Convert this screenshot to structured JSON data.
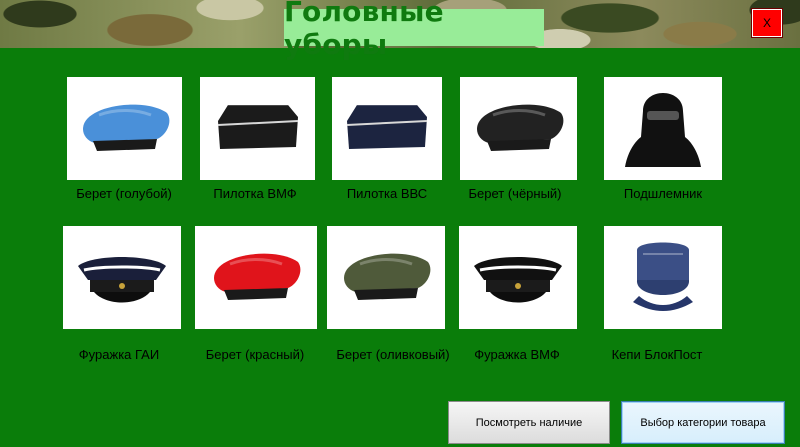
{
  "window": {
    "title": "Головные уборы",
    "close_label": "X"
  },
  "products": [
    {
      "label": "Берет (голубой)",
      "icon": "beret-icon",
      "color": "#4a90d9"
    },
    {
      "label": "Пилотка ВМФ",
      "icon": "garrison-cap-icon",
      "color": "#1b1b1b"
    },
    {
      "label": "Пилотка ВВС",
      "icon": "garrison-cap-icon",
      "color": "#1c2440"
    },
    {
      "label": "Берет (чёрный)",
      "icon": "beret-icon",
      "color": "#222222"
    },
    {
      "label": "Подшлемник",
      "icon": "balaclava-icon",
      "color": "#111111"
    },
    {
      "label": "Фуражка ГАИ",
      "icon": "peaked-cap-icon",
      "color": "#1a1f3a"
    },
    {
      "label": "Берет (красный)",
      "icon": "beret-icon",
      "color": "#e0141b"
    },
    {
      "label": "Берет (оливковый)",
      "icon": "beret-icon",
      "color": "#4f5a3a"
    },
    {
      "label": "Фуражка ВМФ",
      "icon": "peaked-cap-icon",
      "color": "#111111"
    },
    {
      "label": "Кепи БлокПост",
      "icon": "field-cap-icon",
      "color": "#3b4f86"
    }
  ],
  "buttons": {
    "check_stock": "Посмотреть наличие",
    "choose_category": "Выбор категории товара"
  }
}
